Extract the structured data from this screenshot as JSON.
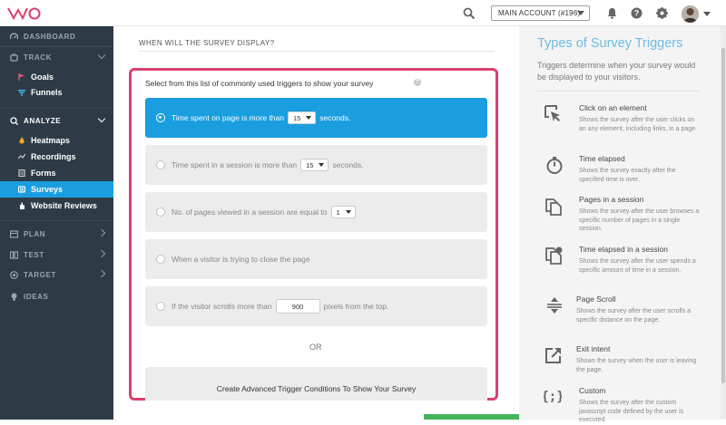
{
  "header": {
    "logo_text": "VWO",
    "account_label": "MAIN ACCOUNT (#196)"
  },
  "sidebar": {
    "dashboard": "DASHBOARD",
    "track": "TRACK",
    "goals": "Goals",
    "funnels": "Funnels",
    "analyze": "ANALYZE",
    "heatmaps": "Heatmaps",
    "recordings": "Recordings",
    "forms": "Forms",
    "surveys": "Surveys",
    "website_reviews": "Website Reviews",
    "plan": "PLAN",
    "test": "TEST",
    "target": "TARGET",
    "ideas": "IDEAS"
  },
  "main": {
    "question": "WHEN WILL THE SURVEY DISPLAY?",
    "intro": "Select from this list of commonly used triggers to show your survey",
    "options": [
      {
        "pre": "Time spent on page is more than",
        "value": "15",
        "post": "seconds."
      },
      {
        "pre": "Time spent in a session is more than",
        "value": "15",
        "post": "seconds."
      },
      {
        "pre": "No. of pages viewed in a session are equal to",
        "value": "1",
        "post": ""
      },
      {
        "pre": "When a visitor is trying to close the page",
        "value": "",
        "post": ""
      },
      {
        "pre": "If the visitor scrolls more than",
        "value": "900",
        "post": "pixels from the top."
      }
    ],
    "or_text": "OR",
    "advanced": "Create Advanced Trigger Conditions To Show Your Survey"
  },
  "panel": {
    "title": "Types of Survey Triggers",
    "desc": "Triggers determine when your survey would be displayed to your visitors.",
    "triggers": [
      {
        "name": "Click on an element",
        "desc": "Shows the survey after the user clicks on an any element, including links, in a page."
      },
      {
        "name": "Time elapsed",
        "desc": "Shows the survey exactly after the specified time is over."
      },
      {
        "name": "Pages in a session",
        "desc": "Shows the survey after the user browses a specific number of pages in a single session."
      },
      {
        "name": "Time elapsed in a session",
        "desc": "Shows the survey after the user spends a specific amount of time in a session."
      },
      {
        "name": "Page Scroll",
        "desc": "Shows the survey after the user scrolls a specific distance on the page."
      },
      {
        "name": "Exit intent",
        "desc": "Shows the survey when the user is leaving the page."
      },
      {
        "name": "Custom",
        "desc": "Shows the survey after the custom javascript code defined by the user is executed."
      }
    ]
  },
  "colors": {
    "accent": "#1a9ee0",
    "highlight": "#d9416e",
    "sidebar": "#2e3b47",
    "panel_title": "#6dbbe6"
  }
}
